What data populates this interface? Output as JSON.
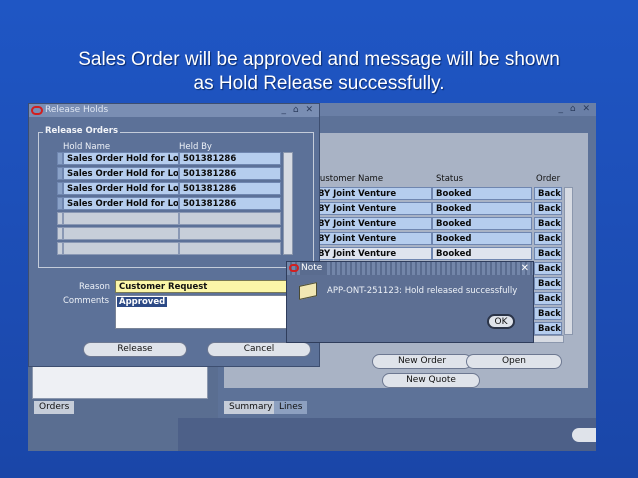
{
  "slide": {
    "title_line1": "Sales Order will be approved and message will be shown",
    "title_line2": "as Hold Release successfully."
  },
  "release_window": {
    "title": "Release Holds",
    "group_label": "Release Orders",
    "columns": [
      "Hold Name",
      "Held By"
    ],
    "rows": [
      {
        "hold_name": "Sales Order Hold for Lo",
        "held_by": "501381286"
      },
      {
        "hold_name": "Sales Order Hold for Lo",
        "held_by": "501381286"
      },
      {
        "hold_name": "Sales Order Hold for Lo",
        "held_by": "501381286"
      },
      {
        "hold_name": "Sales Order Hold for Lo",
        "held_by": "501381286"
      }
    ],
    "reason_label": "Reason",
    "reason_value": "Customer Request",
    "comments_label": "Comments",
    "comments_value": "Approved",
    "release_button": "Release",
    "cancel_button": "Cancel"
  },
  "orders_window": {
    "columns": [
      "Customer Name",
      "Status",
      "Order"
    ],
    "rows": [
      {
        "customer": "BY Joint Venture",
        "status": "Booked",
        "order": "Back"
      },
      {
        "customer": "BY Joint Venture",
        "status": "Booked",
        "order": "Back"
      },
      {
        "customer": "BY Joint Venture",
        "status": "Booked",
        "order": "Back"
      },
      {
        "customer": "BY Joint Venture",
        "status": "Booked",
        "order": "Back"
      },
      {
        "customer": "BY Joint Venture",
        "status": "Booked",
        "order": "Back"
      }
    ],
    "extra_order_cells": [
      "Back",
      "Back",
      "Back",
      "Back",
      "Back"
    ],
    "new_order_button": "New Order",
    "open_button": "Open",
    "new_quote_button": "New Quote",
    "tabs": [
      "Summary",
      "Lines"
    ],
    "left_tab": "Orders"
  },
  "note_dialog": {
    "title": "Note",
    "message": "APP-ONT-251123: Hold released successfully",
    "ok_button": "OK"
  }
}
